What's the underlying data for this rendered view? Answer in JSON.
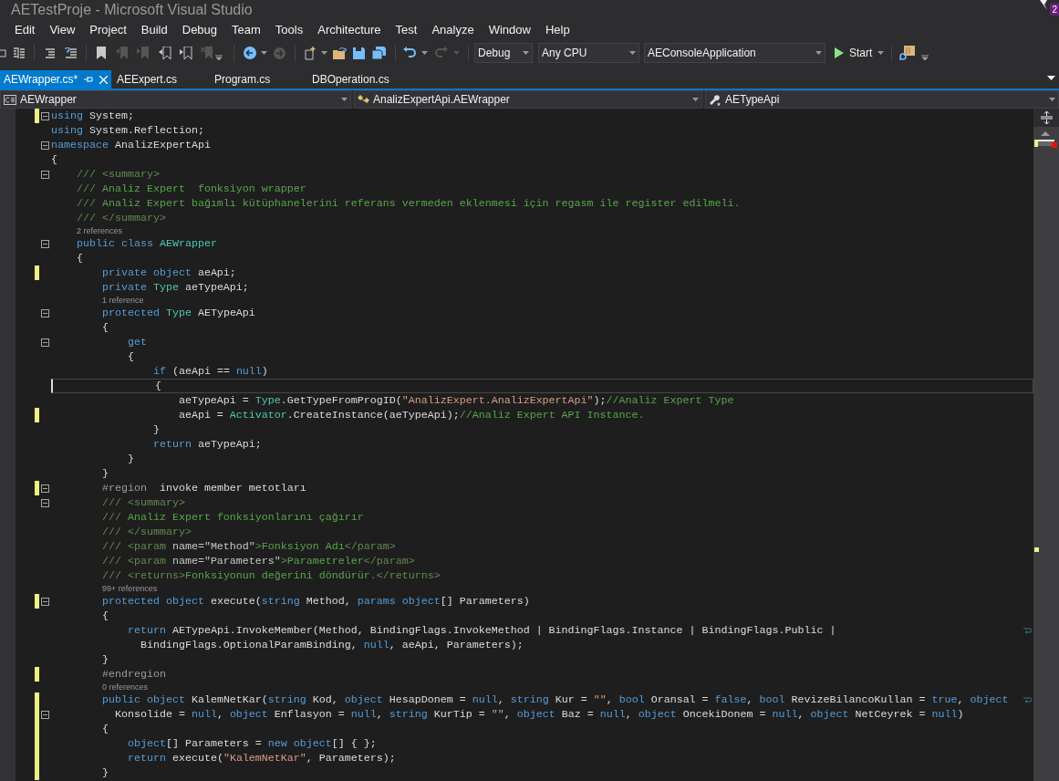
{
  "window": {
    "title": "AETestProje - Microsoft Visual Studio",
    "notification_count": "2"
  },
  "menu": [
    "Edit",
    "View",
    "Project",
    "Build",
    "Debug",
    "Team",
    "Tools",
    "Architecture",
    "Test",
    "Analyze",
    "Window",
    "Help"
  ],
  "toolbar": {
    "configuration": "Debug",
    "platform": "Any CPU",
    "startup_project": "AEConsoleApplication",
    "start_button": "Start"
  },
  "tabs": [
    {
      "label": "AEWrapper.cs*",
      "selected": true
    },
    {
      "label": "AEExpert.cs",
      "selected": false
    },
    {
      "label": "Program.cs",
      "selected": false
    },
    {
      "label": "DBOperation.cs",
      "selected": false
    }
  ],
  "navigation_bar": {
    "project": "AEWrapper",
    "type": "AnalizExpertApi.AEWrapper",
    "member": "AETypeApi"
  },
  "editor": {
    "lines": [
      {
        "kind": "code",
        "changed": true,
        "fold": true,
        "current": false,
        "wrapped": false,
        "tokens": [
          {
            "kind": "kw",
            "text": "using"
          },
          {
            "kind": "plain",
            "text": " System;"
          }
        ]
      },
      {
        "kind": "code",
        "changed": false,
        "fold": false,
        "current": false,
        "wrapped": false,
        "tokens": [
          {
            "kind": "kw",
            "text": "using"
          },
          {
            "kind": "plain",
            "text": " System.Reflection;"
          }
        ]
      },
      {
        "kind": "code",
        "changed": false,
        "fold": true,
        "current": false,
        "wrapped": false,
        "tokens": [
          {
            "kind": "kw",
            "text": "namespace"
          },
          {
            "kind": "plain",
            "text": " AnalizExpertApi"
          }
        ]
      },
      {
        "kind": "code",
        "changed": false,
        "fold": false,
        "current": false,
        "wrapped": false,
        "tokens": [
          {
            "kind": "plain",
            "text": "{"
          }
        ]
      },
      {
        "kind": "code",
        "changed": false,
        "fold": true,
        "current": false,
        "wrapped": false,
        "tokens": [
          {
            "kind": "doc",
            "text": "    /// <summary>"
          }
        ]
      },
      {
        "kind": "code",
        "changed": false,
        "fold": false,
        "current": false,
        "wrapped": false,
        "tokens": [
          {
            "kind": "doc",
            "text": "    ///"
          },
          {
            "kind": "comment",
            "text": " Analiz Expert  fonksiyon wrapper"
          }
        ]
      },
      {
        "kind": "code",
        "changed": false,
        "fold": false,
        "current": false,
        "wrapped": false,
        "tokens": [
          {
            "kind": "doc",
            "text": "    ///"
          },
          {
            "kind": "comment",
            "text": " Analiz Expert bağımlı kütüphanelerini referans vermeden eklenmesi için regasm ile register edilmeli."
          }
        ]
      },
      {
        "kind": "code",
        "changed": false,
        "fold": false,
        "current": false,
        "wrapped": false,
        "tokens": [
          {
            "kind": "doc",
            "text": "    /// </summary>"
          }
        ]
      },
      {
        "kind": "codelens",
        "text": "2 references"
      },
      {
        "kind": "code",
        "changed": false,
        "fold": true,
        "current": false,
        "wrapped": false,
        "tokens": [
          {
            "kind": "kw",
            "text": "    public class "
          },
          {
            "kind": "type",
            "text": "AEWrapper"
          }
        ]
      },
      {
        "kind": "code",
        "changed": false,
        "fold": false,
        "current": false,
        "wrapped": false,
        "tokens": [
          {
            "kind": "plain",
            "text": "    {"
          }
        ]
      },
      {
        "kind": "code",
        "changed": true,
        "fold": false,
        "current": false,
        "wrapped": false,
        "tokens": [
          {
            "kind": "kw",
            "text": "        private object"
          },
          {
            "kind": "plain",
            "text": " aeApi;"
          }
        ]
      },
      {
        "kind": "code",
        "changed": false,
        "fold": false,
        "current": false,
        "wrapped": false,
        "tokens": [
          {
            "kind": "kw",
            "text": "        private "
          },
          {
            "kind": "type",
            "text": "Type"
          },
          {
            "kind": "plain",
            "text": " aeTypeApi;"
          }
        ]
      },
      {
        "kind": "codelens",
        "text": "1 reference"
      },
      {
        "kind": "code",
        "changed": false,
        "fold": true,
        "current": false,
        "wrapped": false,
        "tokens": [
          {
            "kind": "kw",
            "text": "        protected "
          },
          {
            "kind": "type",
            "text": "Type"
          },
          {
            "kind": "plain",
            "text": " AETypeApi"
          }
        ]
      },
      {
        "kind": "code",
        "changed": false,
        "fold": false,
        "current": false,
        "wrapped": false,
        "tokens": [
          {
            "kind": "plain",
            "text": "        {"
          }
        ]
      },
      {
        "kind": "code",
        "changed": false,
        "fold": true,
        "current": false,
        "wrapped": false,
        "tokens": [
          {
            "kind": "kw",
            "text": "            get"
          }
        ]
      },
      {
        "kind": "code",
        "changed": false,
        "fold": false,
        "current": false,
        "wrapped": false,
        "tokens": [
          {
            "kind": "plain",
            "text": "            {"
          }
        ]
      },
      {
        "kind": "code",
        "changed": false,
        "fold": false,
        "current": false,
        "wrapped": false,
        "tokens": [
          {
            "kind": "kw",
            "text": "                if"
          },
          {
            "kind": "plain",
            "text": " (aeApi == "
          },
          {
            "kind": "kw",
            "text": "null"
          },
          {
            "kind": "plain",
            "text": ")"
          }
        ]
      },
      {
        "kind": "code",
        "changed": false,
        "fold": false,
        "current": true,
        "wrapped": false,
        "tokens": [
          {
            "kind": "plain",
            "text": "                {"
          }
        ]
      },
      {
        "kind": "code",
        "changed": false,
        "fold": false,
        "current": false,
        "wrapped": false,
        "tokens": [
          {
            "kind": "plain",
            "text": "                    aeTypeApi = "
          },
          {
            "kind": "type",
            "text": "Type"
          },
          {
            "kind": "plain",
            "text": ".GetTypeFromProgID("
          },
          {
            "kind": "str",
            "text": "\"AnalizExpert.AnalizExpertApi\""
          },
          {
            "kind": "plain",
            "text": ");"
          },
          {
            "kind": "comment",
            "text": "//Analiz Expert Type"
          }
        ]
      },
      {
        "kind": "code",
        "changed": true,
        "fold": false,
        "current": false,
        "wrapped": false,
        "tokens": [
          {
            "kind": "plain",
            "text": "                    aeApi = "
          },
          {
            "kind": "type",
            "text": "Activator"
          },
          {
            "kind": "plain",
            "text": ".CreateInstance(aeTypeApi);"
          },
          {
            "kind": "comment",
            "text": "//Analiz Expert API Instance."
          }
        ]
      },
      {
        "kind": "code",
        "changed": false,
        "fold": false,
        "current": false,
        "wrapped": false,
        "tokens": [
          {
            "kind": "plain",
            "text": "                }"
          }
        ]
      },
      {
        "kind": "code",
        "changed": false,
        "fold": false,
        "current": false,
        "wrapped": false,
        "tokens": [
          {
            "kind": "kw",
            "text": "                return"
          },
          {
            "kind": "plain",
            "text": " aeTypeApi;"
          }
        ]
      },
      {
        "kind": "code",
        "changed": false,
        "fold": false,
        "current": false,
        "wrapped": false,
        "tokens": [
          {
            "kind": "plain",
            "text": "            }"
          }
        ]
      },
      {
        "kind": "code",
        "changed": false,
        "fold": false,
        "current": false,
        "wrapped": false,
        "tokens": [
          {
            "kind": "plain",
            "text": "        }"
          }
        ]
      },
      {
        "kind": "code",
        "changed": true,
        "fold": true,
        "current": false,
        "wrapped": false,
        "tokens": [
          {
            "kind": "region",
            "text": "        #region"
          },
          {
            "kind": "plain",
            "text": "  invoke member metotları"
          }
        ]
      },
      {
        "kind": "code",
        "changed": false,
        "fold": true,
        "current": false,
        "wrapped": false,
        "tokens": [
          {
            "kind": "doc",
            "text": "        /// <summary>"
          }
        ]
      },
      {
        "kind": "code",
        "changed": false,
        "fold": false,
        "current": false,
        "wrapped": false,
        "tokens": [
          {
            "kind": "doc",
            "text": "        ///"
          },
          {
            "kind": "comment",
            "text": " Analiz Expert fonksiyonlarını çağırır"
          }
        ]
      },
      {
        "kind": "code",
        "changed": false,
        "fold": false,
        "current": false,
        "wrapped": false,
        "tokens": [
          {
            "kind": "doc",
            "text": "        /// </summary>"
          }
        ]
      },
      {
        "kind": "code",
        "changed": false,
        "fold": false,
        "current": false,
        "wrapped": false,
        "tokens": [
          {
            "kind": "doc",
            "text": "        /// <param "
          },
          {
            "kind": "attr",
            "text": "name=\"Method\""
          },
          {
            "kind": "doc",
            "text": ">"
          },
          {
            "kind": "comment",
            "text": "Fonksiyon Adı"
          },
          {
            "kind": "doc",
            "text": "</param>"
          }
        ]
      },
      {
        "kind": "code",
        "changed": false,
        "fold": false,
        "current": false,
        "wrapped": false,
        "tokens": [
          {
            "kind": "doc",
            "text": "        /// <param "
          },
          {
            "kind": "attr",
            "text": "name=\"Parameters\""
          },
          {
            "kind": "doc",
            "text": ">"
          },
          {
            "kind": "comment",
            "text": "Parametreler"
          },
          {
            "kind": "doc",
            "text": "</param>"
          }
        ]
      },
      {
        "kind": "code",
        "changed": false,
        "fold": false,
        "current": false,
        "wrapped": false,
        "tokens": [
          {
            "kind": "doc",
            "text": "        /// <returns>"
          },
          {
            "kind": "comment",
            "text": "Fonksiyonun değerini döndürür."
          },
          {
            "kind": "doc",
            "text": "</returns>"
          }
        ]
      },
      {
        "kind": "codelens",
        "text": "99+ references"
      },
      {
        "kind": "code",
        "changed": true,
        "fold": true,
        "current": false,
        "wrapped": false,
        "tokens": [
          {
            "kind": "kw",
            "text": "        protected object"
          },
          {
            "kind": "plain",
            "text": " execute("
          },
          {
            "kind": "kw",
            "text": "string"
          },
          {
            "kind": "plain",
            "text": " Method, "
          },
          {
            "kind": "kw",
            "text": "params object"
          },
          {
            "kind": "plain",
            "text": "[] Parameters)"
          }
        ]
      },
      {
        "kind": "code",
        "changed": false,
        "fold": false,
        "current": false,
        "wrapped": false,
        "tokens": [
          {
            "kind": "plain",
            "text": "        {"
          }
        ]
      },
      {
        "kind": "code",
        "changed": false,
        "fold": false,
        "current": false,
        "wrapped": true,
        "tokens": [
          {
            "kind": "kw",
            "text": "            return"
          },
          {
            "kind": "plain",
            "text": " AETypeApi.InvokeMember(Method, BindingFlags.InvokeMethod | BindingFlags.Instance | BindingFlags.Public |"
          }
        ]
      },
      {
        "kind": "code",
        "changed": false,
        "fold": false,
        "current": false,
        "wrapped": false,
        "tokens": [
          {
            "kind": "plain",
            "text": "              BindingFlags.OptionalParamBinding, "
          },
          {
            "kind": "kw",
            "text": "null"
          },
          {
            "kind": "plain",
            "text": ", aeApi, Parameters);"
          }
        ]
      },
      {
        "kind": "code",
        "changed": false,
        "fold": false,
        "current": false,
        "wrapped": false,
        "tokens": [
          {
            "kind": "plain",
            "text": "        }"
          }
        ]
      },
      {
        "kind": "code",
        "changed": true,
        "fold": false,
        "current": false,
        "wrapped": false,
        "tokens": [
          {
            "kind": "region",
            "text": "        #endregion"
          }
        ]
      },
      {
        "kind": "codelens",
        "text": "0 references"
      },
      {
        "kind": "code",
        "changed": true,
        "fold": false,
        "current": false,
        "wrapped": true,
        "tokens": [
          {
            "kind": "kw",
            "text": "        public object"
          },
          {
            "kind": "plain",
            "text": " KalemNetKar("
          },
          {
            "kind": "kw",
            "text": "string"
          },
          {
            "kind": "plain",
            "text": " Kod, "
          },
          {
            "kind": "kw",
            "text": "object"
          },
          {
            "kind": "plain",
            "text": " HesapDonem = "
          },
          {
            "kind": "kw",
            "text": "null"
          },
          {
            "kind": "plain",
            "text": ", "
          },
          {
            "kind": "kw",
            "text": "string"
          },
          {
            "kind": "plain",
            "text": " Kur = "
          },
          {
            "kind": "str",
            "text": "\"\""
          },
          {
            "kind": "plain",
            "text": ", "
          },
          {
            "kind": "kw",
            "text": "bool"
          },
          {
            "kind": "plain",
            "text": " Oransal = "
          },
          {
            "kind": "kw",
            "text": "false"
          },
          {
            "kind": "plain",
            "text": ", "
          },
          {
            "kind": "kw",
            "text": "bool"
          },
          {
            "kind": "plain",
            "text": " RevizeBilancoKullan = "
          },
          {
            "kind": "kw",
            "text": "true"
          },
          {
            "kind": "plain",
            "text": ", "
          },
          {
            "kind": "kw",
            "text": "object"
          }
        ]
      },
      {
        "kind": "code",
        "changed": true,
        "fold": true,
        "current": false,
        "wrapped": false,
        "tokens": [
          {
            "kind": "plain",
            "text": "          Konsolide = "
          },
          {
            "kind": "kw",
            "text": "null"
          },
          {
            "kind": "plain",
            "text": ", "
          },
          {
            "kind": "kw",
            "text": "object"
          },
          {
            "kind": "plain",
            "text": " Enflasyon = "
          },
          {
            "kind": "kw",
            "text": "null"
          },
          {
            "kind": "plain",
            "text": ", "
          },
          {
            "kind": "kw",
            "text": "string"
          },
          {
            "kind": "plain",
            "text": " KurTip = "
          },
          {
            "kind": "str",
            "text": "\"\""
          },
          {
            "kind": "plain",
            "text": ", "
          },
          {
            "kind": "kw",
            "text": "object"
          },
          {
            "kind": "plain",
            "text": " Baz = "
          },
          {
            "kind": "kw",
            "text": "null"
          },
          {
            "kind": "plain",
            "text": ", "
          },
          {
            "kind": "kw",
            "text": "object"
          },
          {
            "kind": "plain",
            "text": " OncekiDonem = "
          },
          {
            "kind": "kw",
            "text": "null"
          },
          {
            "kind": "plain",
            "text": ", "
          },
          {
            "kind": "kw",
            "text": "object"
          },
          {
            "kind": "plain",
            "text": " NetCeyrek = "
          },
          {
            "kind": "kw",
            "text": "null"
          },
          {
            "kind": "plain",
            "text": ")"
          }
        ]
      },
      {
        "kind": "code",
        "changed": true,
        "fold": false,
        "current": false,
        "wrapped": false,
        "tokens": [
          {
            "kind": "plain",
            "text": "        {"
          }
        ]
      },
      {
        "kind": "code",
        "changed": true,
        "fold": false,
        "current": false,
        "wrapped": false,
        "tokens": [
          {
            "kind": "kw",
            "text": "            object"
          },
          {
            "kind": "plain",
            "text": "[] Parameters = "
          },
          {
            "kind": "kw",
            "text": "new object"
          },
          {
            "kind": "plain",
            "text": "[] { };"
          }
        ]
      },
      {
        "kind": "code",
        "changed": true,
        "fold": false,
        "current": false,
        "wrapped": false,
        "tokens": [
          {
            "kind": "kw",
            "text": "            return"
          },
          {
            "kind": "plain",
            "text": " execute("
          },
          {
            "kind": "str",
            "text": "\"KalemNetKar\""
          },
          {
            "kind": "plain",
            "text": ", Parameters);"
          }
        ]
      },
      {
        "kind": "code",
        "changed": true,
        "fold": false,
        "current": false,
        "wrapped": false,
        "tokens": [
          {
            "kind": "plain",
            "text": "        }"
          }
        ]
      }
    ]
  }
}
